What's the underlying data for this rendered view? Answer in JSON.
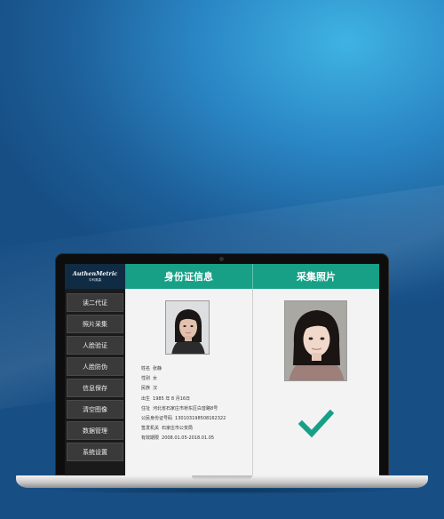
{
  "app": {
    "logo_main": "AuthenMetric",
    "logo_sub": "中科奥森"
  },
  "tabs": {
    "id_info": "身份证信息",
    "collect_photo": "采集照片"
  },
  "sidebar": {
    "items": [
      {
        "label": "读二代证"
      },
      {
        "label": "照片采集"
      },
      {
        "label": "人脸验证"
      },
      {
        "label": "人脸防伪"
      },
      {
        "label": "信息保存"
      },
      {
        "label": "清空图像"
      },
      {
        "label": "数据管理"
      },
      {
        "label": "系统设置"
      }
    ]
  },
  "id_card": {
    "name_label": "姓名",
    "name": "张静",
    "sex_label": "性别",
    "sex": "女",
    "ethnicity_label": "民族",
    "ethnicity": "汉",
    "birth_label": "出生",
    "birth": "1985 年 8 月16日",
    "address_label": "住址",
    "address": "河北省石家庄市桥东区白音路8号",
    "id_label": "公民身份证号码",
    "id_number": "130103198508162322",
    "authority_label": "签发机关",
    "authority": "石家庄市公安局",
    "valid_label": "有效期限",
    "valid": "2008.01.05-2018.01.05"
  },
  "verification": {
    "result_icon": "checkmark-icon",
    "color": "#17a086"
  },
  "colors": {
    "accent": "#17a086",
    "sidebar": "#1a1a1a",
    "logo_bg": "#0f2c44"
  }
}
